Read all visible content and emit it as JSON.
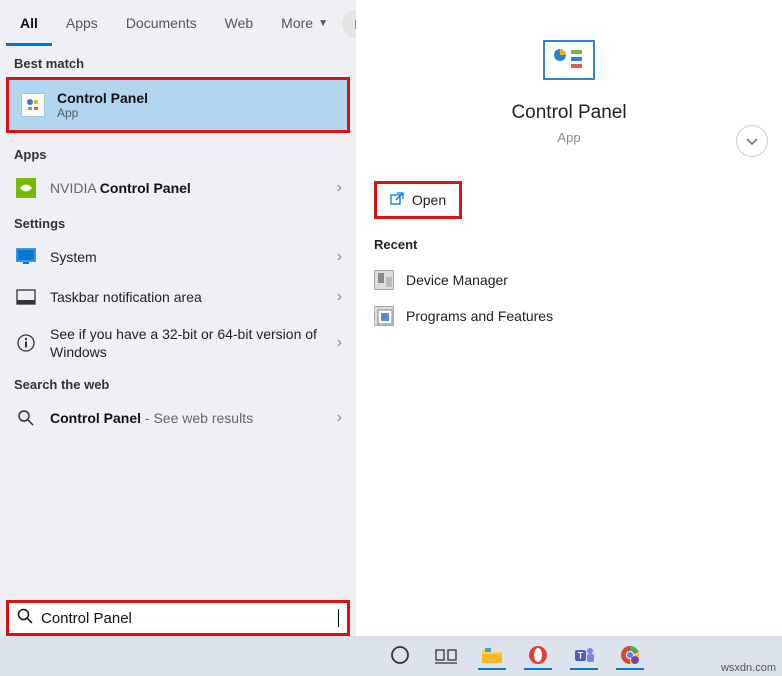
{
  "tabs": {
    "all": "All",
    "apps": "Apps",
    "documents": "Documents",
    "web": "Web",
    "more": "More"
  },
  "avatar": "I",
  "sections": {
    "best_match": "Best match",
    "apps": "Apps",
    "settings": "Settings",
    "search_web": "Search the web",
    "recent": "Recent"
  },
  "best_match": {
    "title": "Control Panel",
    "subtitle": "App"
  },
  "apps_result": {
    "prefix": "NVIDIA ",
    "bold": "Control Panel"
  },
  "settings_results": [
    {
      "label": "System"
    },
    {
      "label": "Taskbar notification area"
    },
    {
      "label": "See if you have a 32-bit or 64-bit version of Windows"
    }
  ],
  "web_result": {
    "bold": "Control Panel",
    "suffix": " - See web results"
  },
  "detail": {
    "title": "Control Panel",
    "subtitle": "App",
    "open": "Open"
  },
  "recent_items": [
    "Device Manager",
    "Programs and Features"
  ],
  "search": {
    "value": "Control Panel"
  },
  "watermark": "wsxdn.com"
}
